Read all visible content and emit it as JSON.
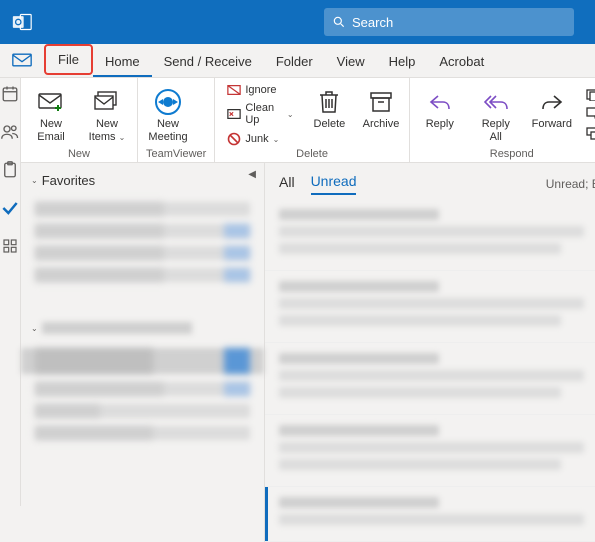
{
  "search": {
    "placeholder": "Search"
  },
  "tabs": {
    "file": "File",
    "home": "Home",
    "sendreceive": "Send / Receive",
    "folder": "Folder",
    "view": "View",
    "help": "Help",
    "acrobat": "Acrobat"
  },
  "ribbon": {
    "new": {
      "group": "New",
      "email": "New\nEmail",
      "items": "New\nItems"
    },
    "tv": {
      "group": "TeamViewer",
      "meeting": "New\nMeeting"
    },
    "delete": {
      "group": "Delete",
      "ignore": "Ignore",
      "cleanup": "Clean Up",
      "junk": "Junk",
      "delete": "Delete",
      "archive": "Archive"
    },
    "respond": {
      "group": "Respond",
      "reply": "Reply",
      "replyall": "Reply\nAll",
      "forward": "Forward"
    }
  },
  "folders": {
    "favorites": "Favorites"
  },
  "reading": {
    "all": "All",
    "unread": "Unread",
    "status": "Unread; B"
  }
}
